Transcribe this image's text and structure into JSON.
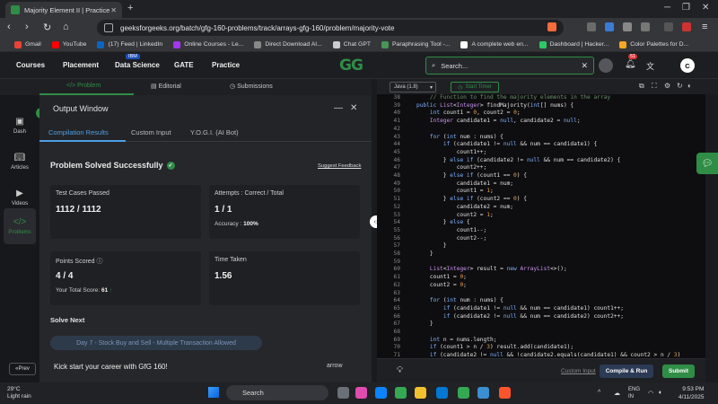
{
  "browser": {
    "tab_title": "Majority Element II | Practice | G",
    "url": "geeksforgeeks.org/batch/gfg-160-problems/track/arrays-gfg-160/problem/majority-vote",
    "bookmarks": [
      {
        "label": "Gmail",
        "color": "#ea4335"
      },
      {
        "label": "YouTube",
        "color": "#ff0000"
      },
      {
        "label": "(17) Feed | LinkedIn",
        "color": "#0a66c2"
      },
      {
        "label": "Online Courses - Le...",
        "color": "#a435f0"
      },
      {
        "label": "Direct Download AI...",
        "color": "#888888"
      },
      {
        "label": "Chat GPT",
        "color": "#cccccc"
      },
      {
        "label": "Paraphrasing Tool -...",
        "color": "#499557"
      },
      {
        "label": "A complete web en...",
        "color": "#ffffff"
      },
      {
        "label": "Dashboard | Hacker...",
        "color": "#2ec866"
      },
      {
        "label": "Color Palettes for D...",
        "color": "#f5a623"
      }
    ]
  },
  "site": {
    "menu": [
      "Courses",
      "Placement",
      "Data Science",
      "GATE",
      "Practice"
    ],
    "ibm_badge": "IBM",
    "logo": "GG",
    "search_placeholder": "Search...",
    "notifications": "51",
    "avatar_initial": "C"
  },
  "problem_tabs": [
    "Problem",
    "Editorial",
    "Submissions"
  ],
  "rail": {
    "items": [
      "Dash",
      "Articles",
      "Videos",
      "Problems"
    ],
    "prev": "Prev"
  },
  "output": {
    "title": "Output Window",
    "tabs": [
      "Compilation Results",
      "Custom Input",
      "Y.O.G.I. (AI Bot)"
    ],
    "status": "Problem Solved Successfully",
    "feedback": "Suggest Feedback",
    "test_cases_label": "Test Cases Passed",
    "test_cases_value": "1112 / 1112",
    "attempts_label": "Attempts : Correct / Total",
    "attempts_value": "1 / 1",
    "accuracy_label": "Accuracy :",
    "accuracy_value": "100%",
    "points_label": "Points Scored",
    "points_value": "4 / 4",
    "total_score_label": "Your Total Score:",
    "total_score_value": "61",
    "time_label": "Time Taken",
    "time_value": "1.56",
    "solve_next": "Solve Next",
    "next_problem": "Day 7 - Stock Buy and Sell - Multiple Transaction Allowed",
    "kickstart": "Kick start your career with GfG 160!",
    "arrow_link": "arrow"
  },
  "editor": {
    "language": "Java (1.8)",
    "timer": "Start Timer",
    "line_numbers": [
      "38",
      "39",
      "40",
      "41",
      "42",
      "43",
      "44",
      "45",
      "46",
      "47",
      "48",
      "49",
      "50",
      "51",
      "52",
      "53",
      "54",
      "55",
      "56",
      "57",
      "58",
      "59",
      "60",
      "61",
      "62",
      "63",
      "64",
      "65",
      "66",
      "67",
      "68",
      "69",
      "70",
      "71",
      "72",
      "73"
    ],
    "custom_input": "Custom Input",
    "compile_run": "Compile & Run",
    "submit": "Submit"
  },
  "taskbar": {
    "temp": "29°C",
    "weather": "Light rain",
    "search": "Search",
    "lang_top": "ENG",
    "lang_bottom": "IN",
    "time": "9:53 PM",
    "date": "4/11/2025"
  },
  "colors": {
    "accent_green": "#2f8d46",
    "accent_blue": "#4f9fe6"
  }
}
